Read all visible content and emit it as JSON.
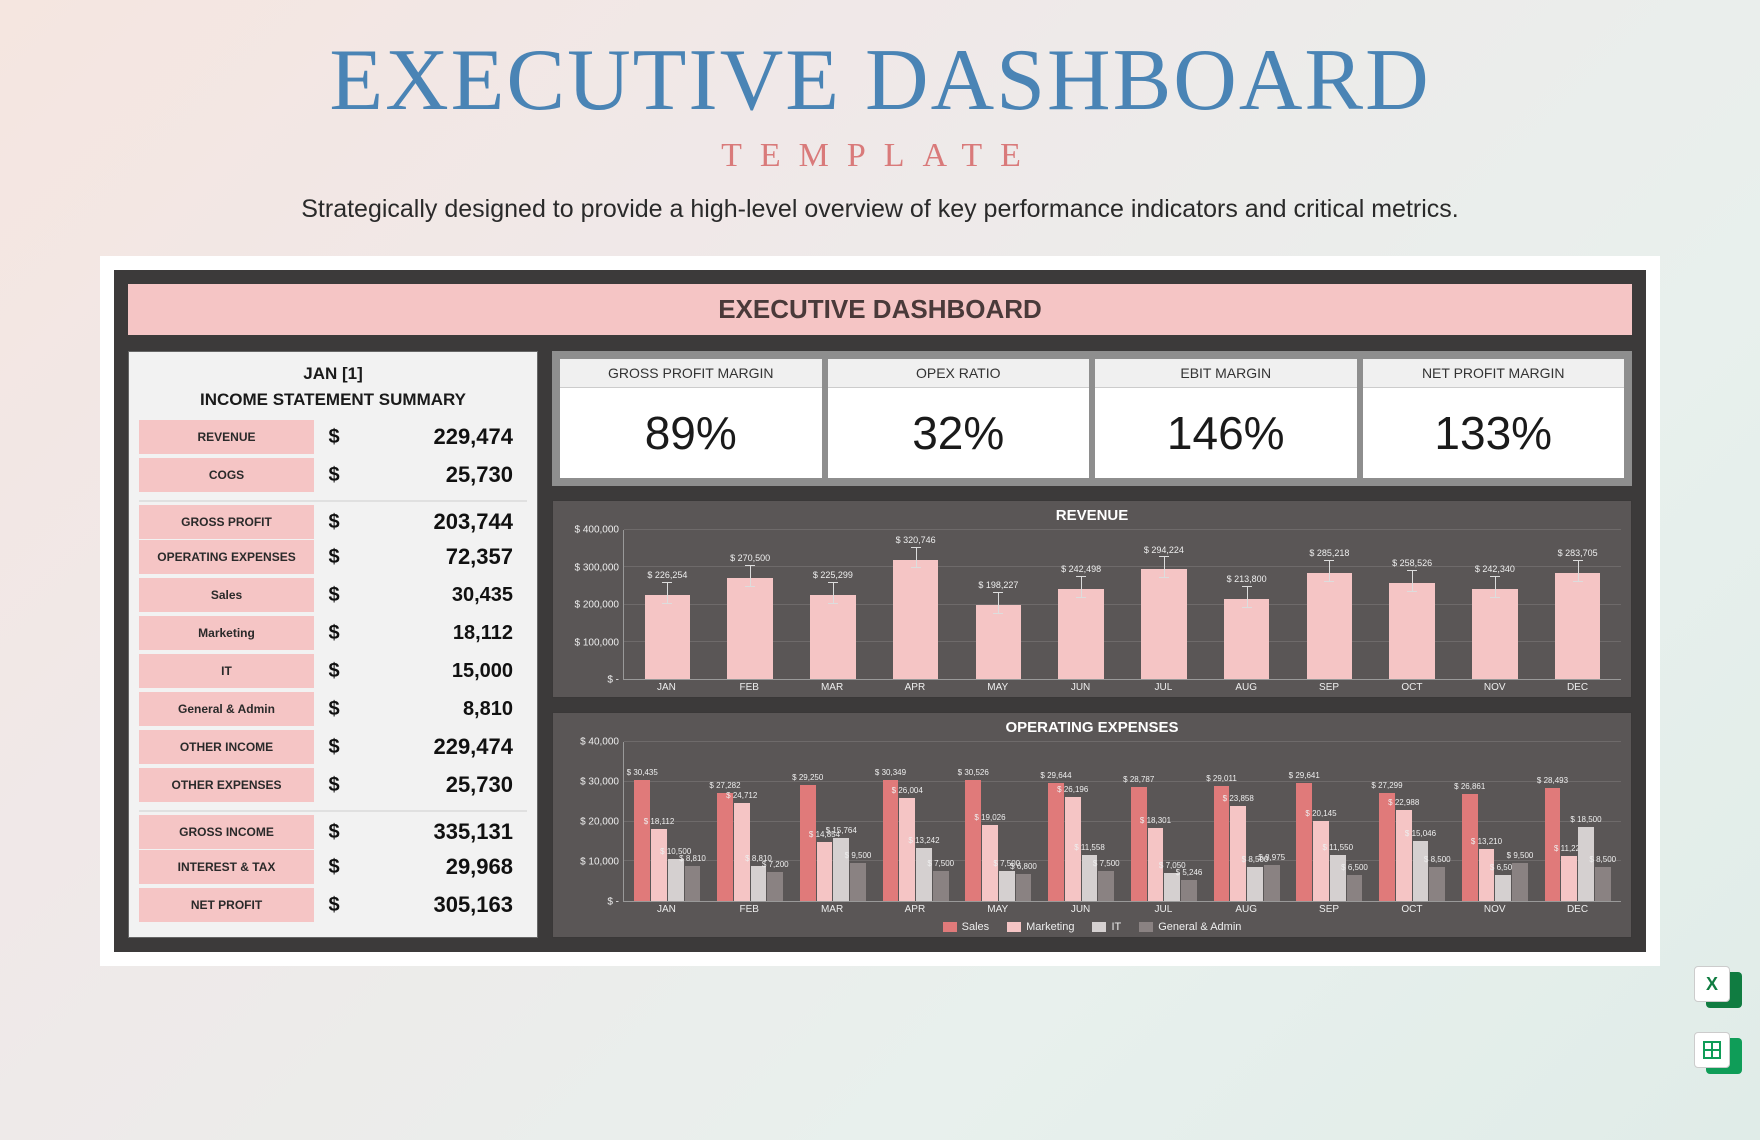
{
  "header": {
    "title": "EXECUTIVE DASHBOARD",
    "subtitle": "TEMPLATE",
    "tagline": "Strategically designed to provide a high-level overview of key performance indicators and critical metrics."
  },
  "banner": "EXECUTIVE DASHBOARD",
  "period": "JAN [1]",
  "income_statement": {
    "title": "INCOME STATEMENT SUMMARY",
    "rows": [
      {
        "label": "REVENUE",
        "value": "229,474",
        "style": "main"
      },
      {
        "label": "COGS",
        "value": "25,730",
        "style": "main"
      },
      {
        "label": "GROSS PROFIT",
        "value": "203,744",
        "style": "main",
        "gap": true
      },
      {
        "label": "OPERATING EXPENSES",
        "value": "72,357",
        "style": "main"
      },
      {
        "label": "Sales",
        "value": "30,435",
        "style": "sub"
      },
      {
        "label": "Marketing",
        "value": "18,112",
        "style": "sub"
      },
      {
        "label": "IT",
        "value": "15,000",
        "style": "sub"
      },
      {
        "label": "General & Admin",
        "value": "8,810",
        "style": "sub"
      },
      {
        "label": "OTHER INCOME",
        "value": "229,474",
        "style": "main"
      },
      {
        "label": "OTHER EXPENSES",
        "value": "25,730",
        "style": "main"
      },
      {
        "label": "GROSS INCOME",
        "value": "335,131",
        "style": "main",
        "gap": true
      },
      {
        "label": "INTEREST & TAX",
        "value": "29,968",
        "style": "main"
      },
      {
        "label": "NET PROFIT",
        "value": "305,163",
        "style": "main"
      }
    ]
  },
  "kpis": [
    {
      "label": "GROSS PROFIT MARGIN",
      "value": "89%"
    },
    {
      "label": "OPEX RATIO",
      "value": "32%"
    },
    {
      "label": "EBIT MARGIN",
      "value": "146%"
    },
    {
      "label": "NET PROFIT MARGIN",
      "value": "133%"
    }
  ],
  "revenue_chart": {
    "title": "REVENUE",
    "ylabels": [
      "$ 400,000",
      "$ 300,000",
      "$ 200,000",
      "$ 100,000",
      "$ -"
    ]
  },
  "opex_chart": {
    "title": "OPERATING EXPENSES",
    "ylabels": [
      "$ 40,000",
      "$ 30,000",
      "$ 20,000",
      "$ 10,000",
      "$ -"
    ],
    "legend": [
      "Sales",
      "Marketing",
      "IT",
      "General & Admin"
    ]
  },
  "months": [
    "JAN",
    "FEB",
    "MAR",
    "APR",
    "MAY",
    "JUN",
    "JUL",
    "AUG",
    "SEP",
    "OCT",
    "NOV",
    "DEC"
  ],
  "chart_data": [
    {
      "type": "bar",
      "title": "REVENUE",
      "xlabel": "",
      "ylabel": "",
      "ylim": [
        0,
        400000
      ],
      "categories": [
        "JAN",
        "FEB",
        "MAR",
        "APR",
        "MAY",
        "JUN",
        "JUL",
        "AUG",
        "SEP",
        "OCT",
        "NOV",
        "DEC"
      ],
      "values": [
        226254,
        270500,
        225299,
        320746,
        198227,
        242498,
        294224,
        213800,
        285218,
        258526,
        242340,
        283705
      ],
      "data_labels": [
        "$ 226,254",
        "$ 270,500",
        "$ 225,299",
        "$ 320,746",
        "$ 198,227",
        "$ 242,498",
        "$ 294,224",
        "$ 213,800",
        "$ 285,218",
        "$ 258,526",
        "$ 242,340",
        "$ 283,705"
      ],
      "error_bars": true
    },
    {
      "type": "bar",
      "title": "OPERATING EXPENSES",
      "xlabel": "",
      "ylabel": "",
      "ylim": [
        0,
        40000
      ],
      "categories": [
        "JAN",
        "FEB",
        "MAR",
        "APR",
        "MAY",
        "JUN",
        "JUL",
        "AUG",
        "SEP",
        "OCT",
        "NOV",
        "DEC"
      ],
      "series": [
        {
          "name": "Sales",
          "color": "#e07a7a",
          "values": [
            30435,
            27282,
            29250,
            30349,
            30526,
            29644,
            28787,
            29011,
            29641,
            27299,
            26861,
            28493
          ]
        },
        {
          "name": "Marketing",
          "color": "#f5c5c5",
          "values": [
            18112,
            24712,
            14854,
            26004,
            19026,
            26196,
            18301,
            23858,
            20145,
            22988,
            13210,
            11226
          ]
        },
        {
          "name": "IT",
          "color": "#d5d0d0",
          "values": [
            10500,
            8810,
            15764,
            13242,
            7500,
            11558,
            7050,
            8500,
            11550,
            15046,
            6500,
            18500
          ]
        },
        {
          "name": "General & Admin",
          "color": "#8a8282",
          "values": [
            8810,
            7200,
            9500,
            7500,
            6800,
            7500,
            5246,
            8975,
            6500,
            8500,
            9500,
            8500
          ]
        }
      ]
    }
  ],
  "file_icons": [
    "excel-icon",
    "sheets-icon"
  ]
}
